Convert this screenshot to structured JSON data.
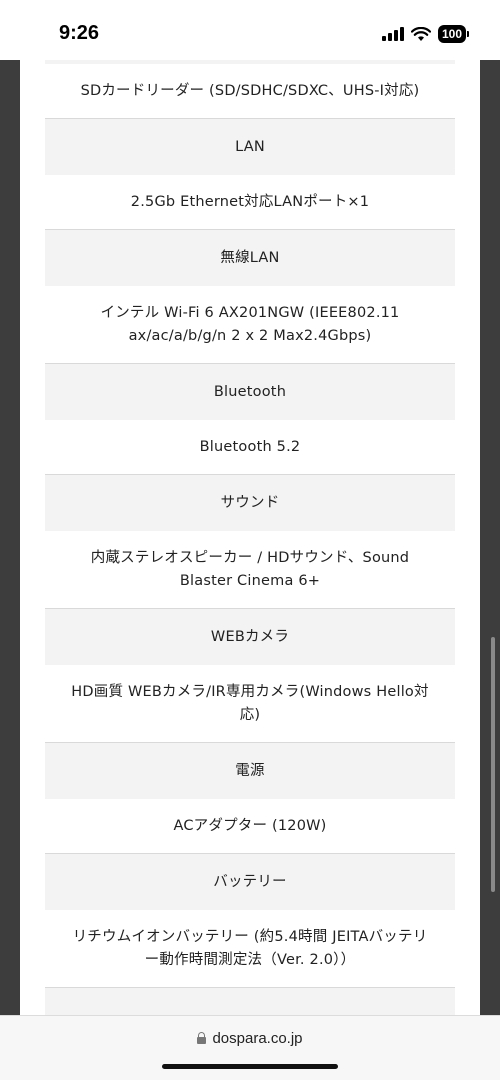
{
  "status_bar": {
    "time": "9:26",
    "battery": "100"
  },
  "specs": [
    {
      "kind": "label",
      "text": ""
    },
    {
      "kind": "value",
      "text": "SDカードリーダー (SD/SDHC/SDXC、UHS-I対応)"
    },
    {
      "kind": "label",
      "text": "LAN"
    },
    {
      "kind": "value",
      "text": "2.5Gb Ethernet対応LANポート×1"
    },
    {
      "kind": "label",
      "text": "無線LAN"
    },
    {
      "kind": "value",
      "text": "インテル Wi-Fi 6 AX201NGW (IEEE802.11 ax/ac/a/b/g/n 2 x 2 Max2.4Gbps)"
    },
    {
      "kind": "label",
      "text": "Bluetooth"
    },
    {
      "kind": "value",
      "text": "Bluetooth 5.2"
    },
    {
      "kind": "label",
      "text": "サウンド"
    },
    {
      "kind": "value",
      "text": "内蔵ステレオスピーカー / HDサウンド、Sound Blaster Cinema 6+"
    },
    {
      "kind": "label",
      "text": "WEBカメラ"
    },
    {
      "kind": "value",
      "text": "HD画質 WEBカメラ/IR専用カメラ(Windows Hello対応)"
    },
    {
      "kind": "label",
      "text": "電源"
    },
    {
      "kind": "value",
      "text": "ACアダプター (120W)"
    },
    {
      "kind": "label",
      "text": "バッテリー"
    },
    {
      "kind": "value",
      "text": "リチウムイオンバッテリー (約5.4時間 JEITAバッテリー動作時間測定法（Ver. 2.0））"
    },
    {
      "kind": "label",
      "text": ""
    }
  ],
  "browser": {
    "url": "dospara.co.jp"
  }
}
